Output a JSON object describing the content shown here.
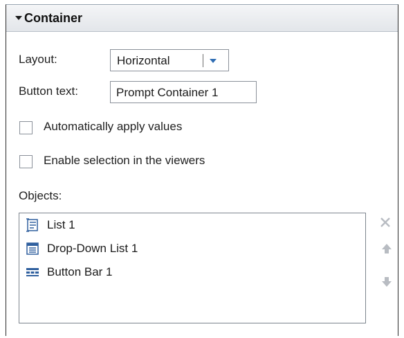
{
  "header": {
    "title": "Container"
  },
  "layout": {
    "label": "Layout:",
    "value": "Horizontal"
  },
  "button_text": {
    "label": "Button text:",
    "value": "Prompt Container 1"
  },
  "options": {
    "auto_apply": {
      "label": "Automatically apply values",
      "checked": false
    },
    "enable_selection": {
      "label": "Enable selection in the viewers",
      "checked": false
    }
  },
  "objects": {
    "label": "Objects:",
    "items": [
      {
        "label": "List 1",
        "icon": "list-icon"
      },
      {
        "label": "Drop-Down List 1",
        "icon": "dropdown-list-icon"
      },
      {
        "label": "Button Bar 1",
        "icon": "button-bar-icon"
      }
    ],
    "actions": [
      "delete-icon",
      "move-up-icon",
      "move-down-icon"
    ]
  },
  "colors": {
    "accent": "#2f6db3",
    "border": "#8a9099",
    "disabled_icon": "#b8bcc2"
  }
}
